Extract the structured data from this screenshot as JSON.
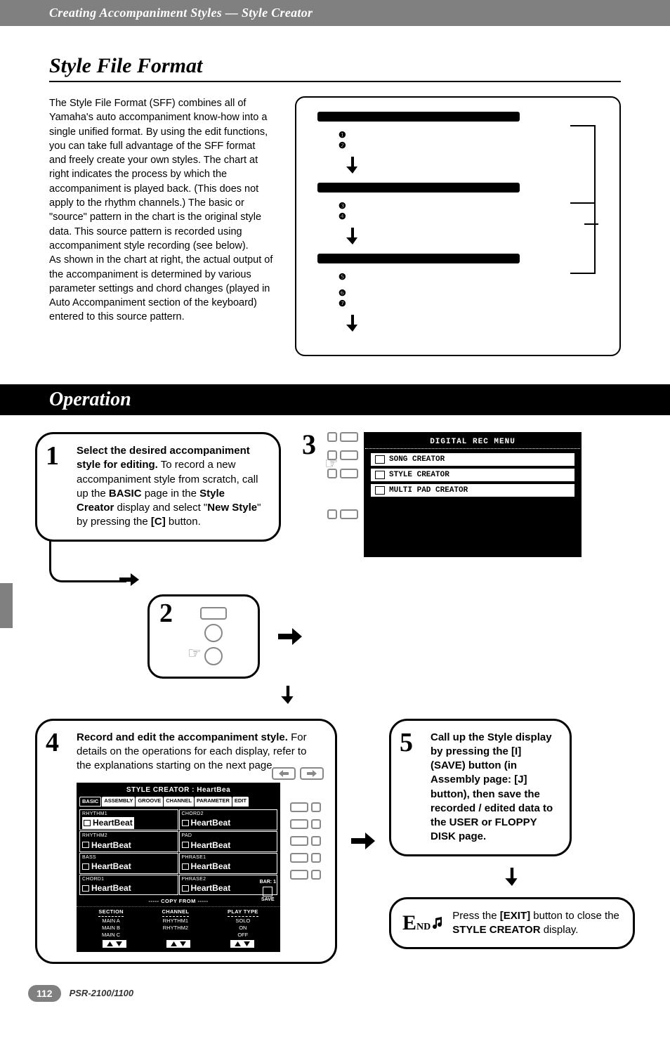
{
  "header": {
    "breadcrumb": "Creating Accompaniment Styles — Style Creator"
  },
  "section": {
    "title": "Style File Format",
    "intro": "The Style File Format (SFF) combines all of Yamaha's auto accompaniment know-how into a single unified format. By using the edit functions, you can take full advantage of the SFF format and freely create your own styles. The chart at right indicates the process by which the accompaniment is played back. (This does not apply to the rhythm channels.) The basic or \"source\" pattern in the chart is the original style data. This source pattern is recorded using accompaniment style recording (see below).",
    "intro2": "As shown in the chart at right, the actual output of the accompaniment is determined by various parameter settings and chord changes (played in Auto Accompaniment section of the keyboard) entered to this source pattern."
  },
  "chart_nums": {
    "a": "❶",
    "b": "❷",
    "c": "❸",
    "d": "❹",
    "e": "❺",
    "f": "❻",
    "g": "❼"
  },
  "operation": {
    "title": "Operation"
  },
  "steps": {
    "s1": {
      "num": "1",
      "bold1": "Select the desired accompaniment style for editing.",
      "text1": " To record a new accompaniment style from scratch, call up the ",
      "bold2": "BASIC",
      "text2": " page in the ",
      "bold3": "Style Creator",
      "text3": " display and select \"",
      "bold4": "New Style",
      "text4": "\" by pressing the ",
      "bold5": "[C]",
      "text5": " button."
    },
    "s2": {
      "num": "2"
    },
    "s3": {
      "num": "3",
      "menu_title": "DIGITAL REC MENU",
      "items": [
        "SONG CREATOR",
        "STYLE CREATOR",
        "MULTI PAD CREATOR"
      ]
    },
    "s4": {
      "num": "4",
      "bold1": "Record and edit the accompaniment style.",
      "text1": " For details on the operations for each display, refer to the explanations starting on the next page."
    },
    "s5": {
      "num": "5",
      "text": "Call up the Style display by pressing the [I] (SAVE) button (in Assembly page: [J] button), then save the recorded / edited data to the USER or FLOPPY DISK page."
    },
    "end": {
      "label_e": "E",
      "label_nd": "ND",
      "text1": "Press the ",
      "bold1": "[EXIT]",
      "text2": " button to close the ",
      "bold2": "STYLE CREATOR",
      "text3": " display."
    }
  },
  "lcd": {
    "title": "STYLE CREATOR : HeartBea",
    "tabs": [
      "BASIC",
      "ASSEMBLY",
      "GROOVE",
      "CHANNEL",
      "PARAMETER",
      "EDIT"
    ],
    "cells": [
      {
        "lbl": "RHYTHM1",
        "val": "HeartBeat",
        "hl": true
      },
      {
        "lbl": "CHORD2",
        "val": "HeartBeat"
      },
      {
        "lbl": "RHYTHM2",
        "val": "HeartBeat"
      },
      {
        "lbl": "PAD",
        "val": "HeartBeat"
      },
      {
        "lbl": "BASS",
        "val": "HeartBeat"
      },
      {
        "lbl": "PHRASE1",
        "val": "HeartBeat"
      },
      {
        "lbl": "CHORD1",
        "val": "HeartBeat"
      },
      {
        "lbl": "PHRASE2",
        "val": "HeartBeat"
      }
    ],
    "bar_label": "BAR:",
    "bar_val": "1",
    "save": "SAVE",
    "copy_from": "COPY FROM",
    "cols": {
      "section": {
        "h": "SECTION",
        "v": [
          "MAIN A",
          "MAIN B",
          "MAIN C"
        ]
      },
      "channel": {
        "h": "CHANNEL",
        "v": [
          "RHYTHM1",
          "RHYTHM2"
        ]
      },
      "play": {
        "h": "PLAY TYPE",
        "v": [
          "SOLO",
          "ON",
          "OFF"
        ]
      }
    }
  },
  "footer": {
    "page": "112",
    "model": "PSR-2100/1100"
  }
}
